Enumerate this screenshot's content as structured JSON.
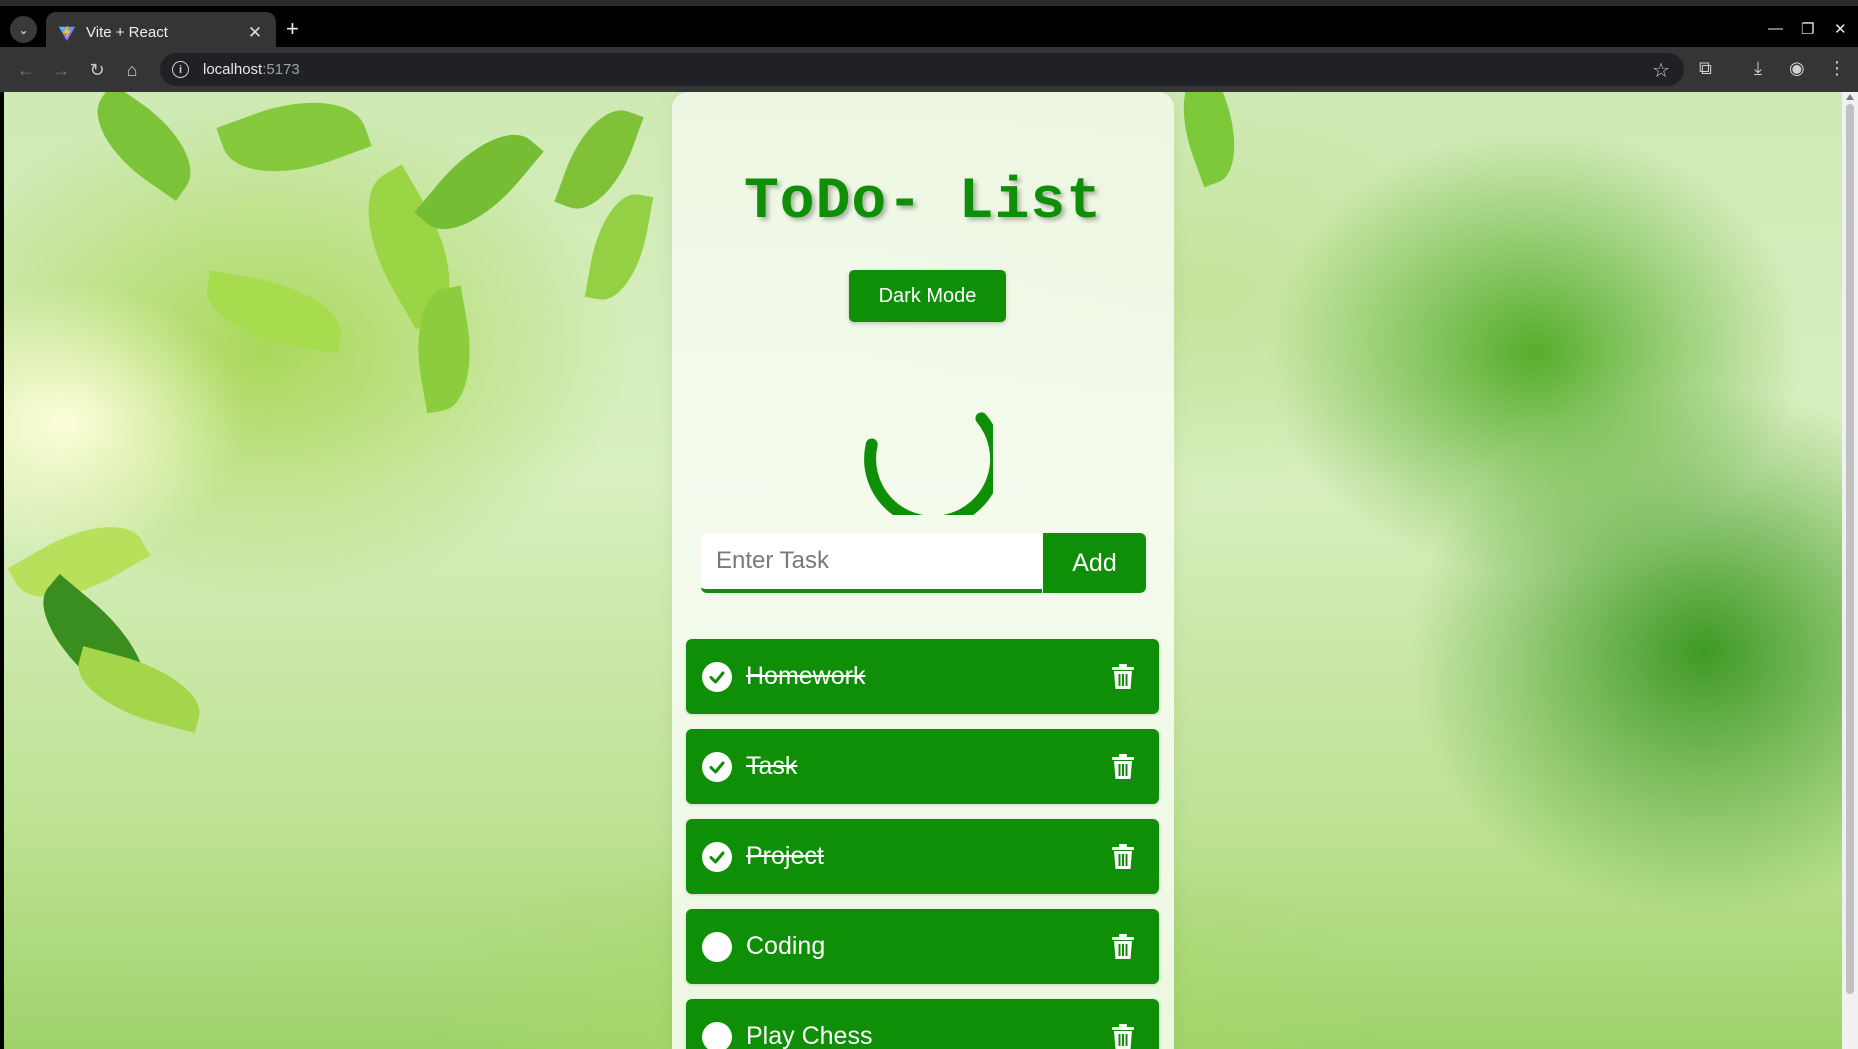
{
  "browser": {
    "tab_title": "Vite + React",
    "url_host": "localhost",
    "url_port": ":5173"
  },
  "app": {
    "title": "ToDo- List",
    "dark_mode_label": "Dark Mode",
    "input_placeholder": "Enter Task",
    "input_value": "",
    "add_label": "Add",
    "accent_color": "#0f8f07",
    "tasks": [
      {
        "text": "Homework",
        "done": true
      },
      {
        "text": "Task",
        "done": true
      },
      {
        "text": "Project",
        "done": true
      },
      {
        "text": "Coding",
        "done": false
      },
      {
        "text": "Play Chess",
        "done": false
      }
    ]
  }
}
